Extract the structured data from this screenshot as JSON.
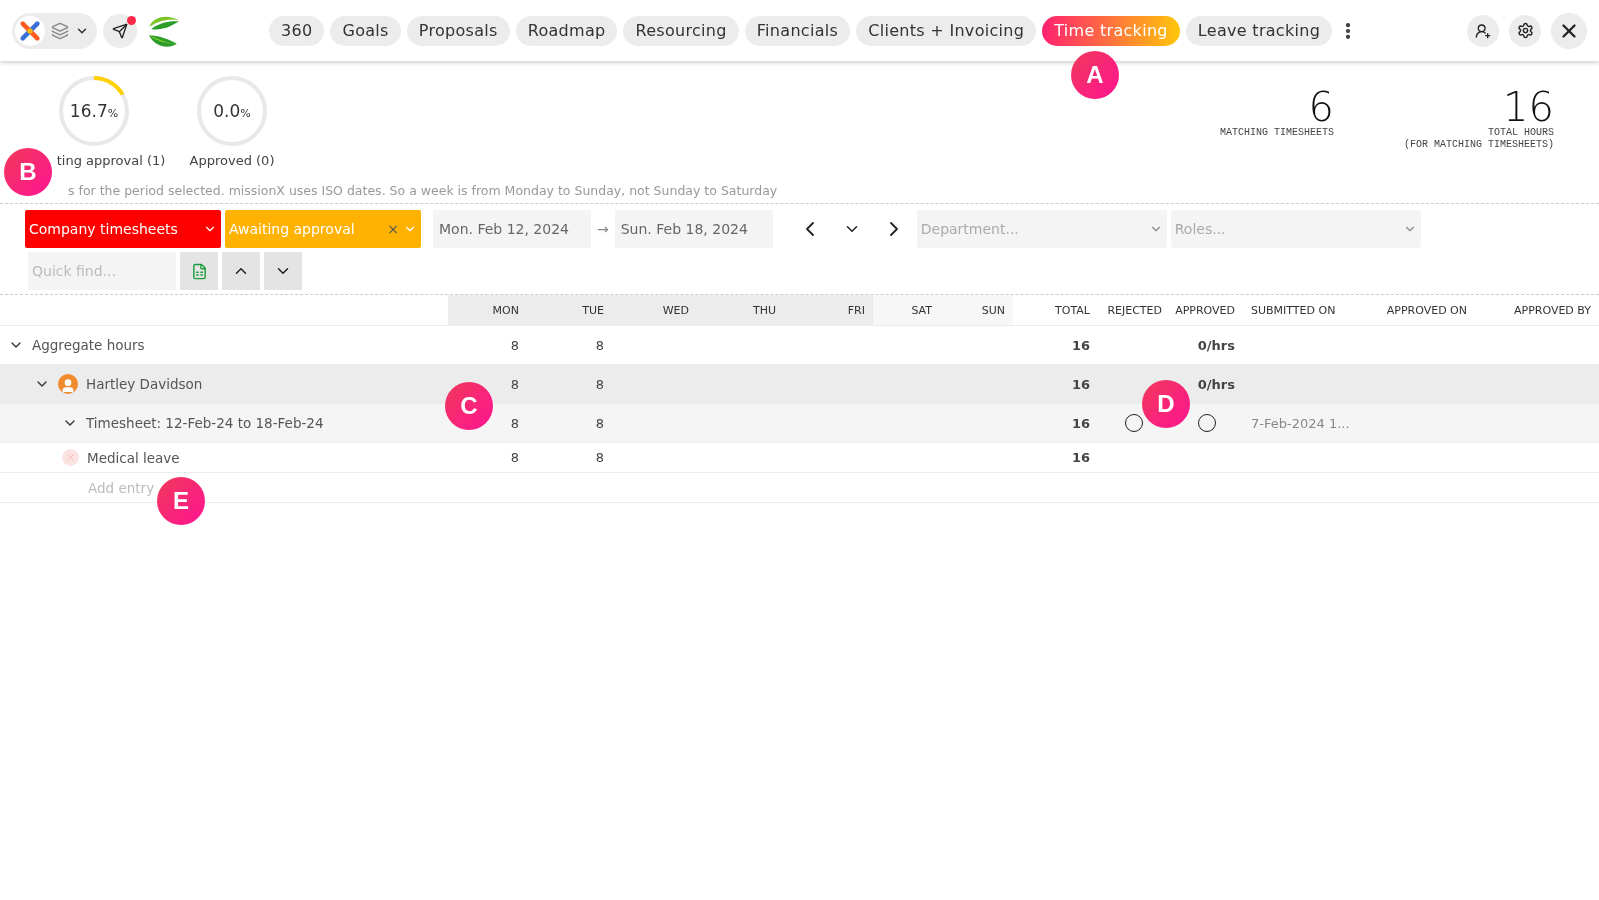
{
  "topbar": {
    "tabs": [
      {
        "label": "360",
        "selected": false
      },
      {
        "label": "Goals",
        "selected": false
      },
      {
        "label": "Proposals",
        "selected": false
      },
      {
        "label": "Roadmap",
        "selected": false
      },
      {
        "label": "Resourcing",
        "selected": false
      },
      {
        "label": "Financials",
        "selected": false
      },
      {
        "label": "Clients + Invoicing",
        "selected": false
      },
      {
        "label": "Time tracking",
        "selected": true
      },
      {
        "label": "Leave tracking",
        "selected": false
      }
    ],
    "notification": true
  },
  "gauges": [
    {
      "value": "16.7",
      "unit": "%",
      "label": "ting approval (1)",
      "level": 0.167
    },
    {
      "value": "0.0",
      "unit": "%",
      "label": "Approved (0)",
      "level": 0
    }
  ],
  "stats": [
    {
      "value": "6",
      "label": "MATCHING TIMESHEETS"
    },
    {
      "value": "16",
      "label": "TOTAL HOURS",
      "sublabel": "(FOR MATCHING TIMESHEETS)"
    }
  ],
  "note": "s for the period selected. missionX uses ISO dates. So a week is from Monday to Sunday, not Sunday to Saturday",
  "filters": {
    "scope": {
      "value": "Company timesheets",
      "color": "#ff0000"
    },
    "status": {
      "value": "Awaiting approval",
      "color": "#ffb300",
      "clear": "×"
    },
    "start_date": "Mon. Feb 12, 2024",
    "arrow": "→",
    "end_date": "Sun. Feb 18, 2024",
    "department": {
      "placeholder": "Department..."
    },
    "roles": {
      "placeholder": "Roles..."
    },
    "quick_find": {
      "placeholder": "Quick find..."
    }
  },
  "table": {
    "columns": [
      "MON",
      "TUE",
      "WED",
      "THU",
      "FRI",
      "SAT",
      "SUN",
      "TOTAL",
      "REJECTED",
      "APPROVED",
      "SUBMITTED ON",
      "APPROVED ON",
      "APPROVED BY"
    ],
    "rows": [
      {
        "kind": "group",
        "name": "Aggregate hours",
        "expanded": true,
        "days": [
          "8",
          "8"
        ],
        "total": "16",
        "approved": "0/hrs"
      },
      {
        "kind": "person",
        "name": "Hartley Davidson",
        "expanded": true,
        "days": [
          "8",
          "8"
        ],
        "total": "16",
        "approved": "0/hrs"
      },
      {
        "kind": "timesheet",
        "name": "Timesheet: 12-Feb-24 to 18-Feb-24",
        "expanded": true,
        "days": [
          "8",
          "8"
        ],
        "total": "16",
        "rejected_checked": false,
        "approved_checked": false,
        "submitted_on": "7-Feb-2024 1..."
      },
      {
        "kind": "entry",
        "name": "Medical leave",
        "days": [
          "8",
          "8"
        ],
        "total": "16"
      },
      {
        "kind": "add",
        "name": "Add entry"
      }
    ]
  },
  "callouts": [
    {
      "label": "A"
    },
    {
      "label": "B"
    },
    {
      "label": "C"
    },
    {
      "label": "D"
    },
    {
      "label": "E"
    }
  ]
}
